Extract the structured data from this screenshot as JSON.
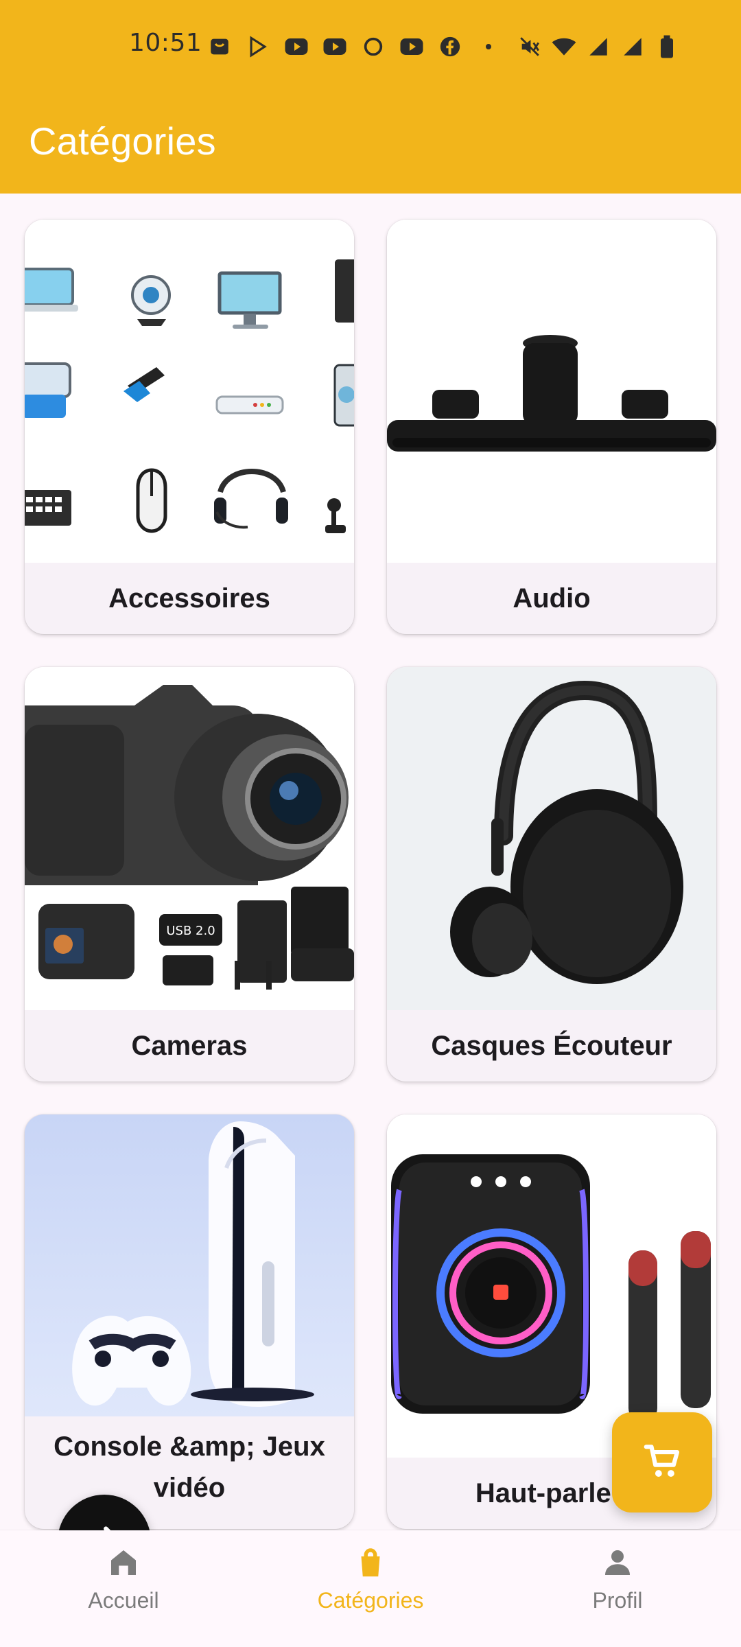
{
  "status_bar": {
    "time": "10:51",
    "notification_icons": [
      "shopping-bag-icon",
      "play-store-icon",
      "youtube-icon",
      "youtube-icon",
      "circle-icon",
      "youtube-icon",
      "facebook-icon",
      "dot-icon"
    ],
    "system_icons": [
      "mute-icon",
      "wifi-icon",
      "cellular-signal-icon",
      "cellular-signal-icon",
      "battery-icon"
    ]
  },
  "header": {
    "title": "Catégories"
  },
  "categories": [
    {
      "label": "Accessoires"
    },
    {
      "label": "Audio"
    },
    {
      "label": "Cameras"
    },
    {
      "label": "Casques Écouteur"
    },
    {
      "label": "Console &amp; Jeux vidéo"
    },
    {
      "label": "Haut-parleu"
    }
  ],
  "bottom_nav": {
    "items": [
      {
        "label": "Accueil",
        "icon": "home-icon"
      },
      {
        "label": "Catégories",
        "icon": "shopping-bag-icon"
      },
      {
        "label": "Profil",
        "icon": "person-icon"
      }
    ],
    "active_index": 1
  },
  "floating_actions": {
    "cart": {
      "icon": "shopping-cart-icon"
    },
    "swap": {
      "icon": "swap-arrows-icon"
    }
  },
  "colors": {
    "accent": "#f2b51b",
    "background": "#fdf6fb",
    "card": "#f7f1f7",
    "text": "#1d1b1f",
    "nav_inactive": "#7b7b7b",
    "swap_fab": "#111111"
  }
}
